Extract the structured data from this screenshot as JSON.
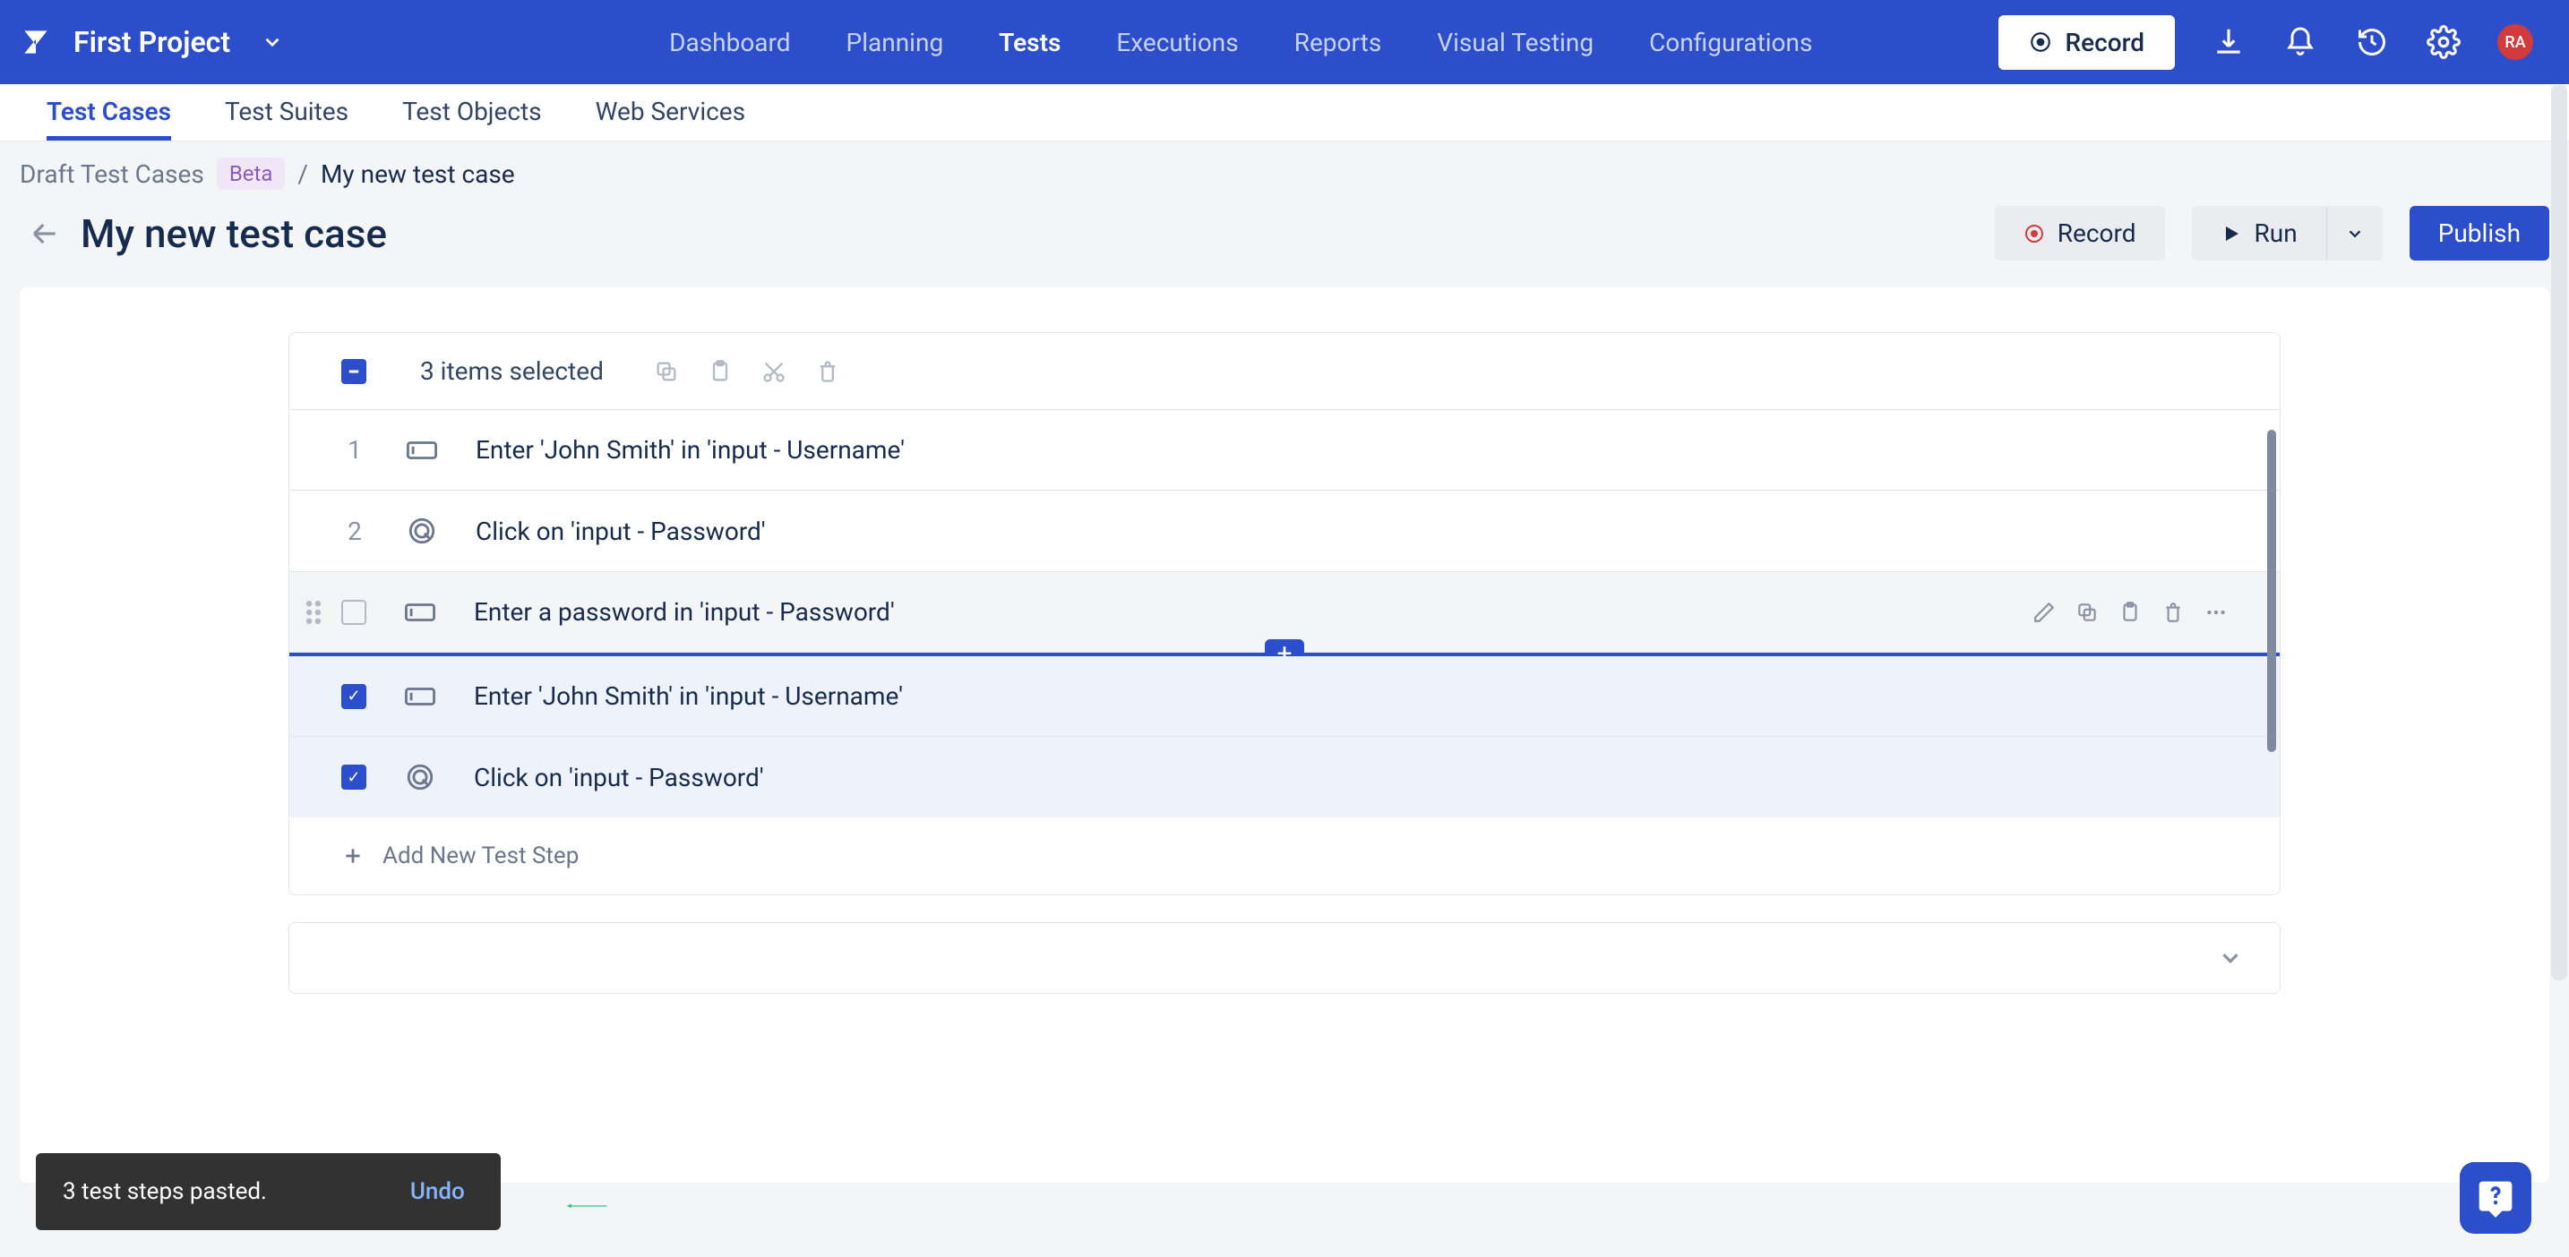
{
  "header": {
    "project_name": "First Project",
    "nav": [
      "Dashboard",
      "Planning",
      "Tests",
      "Executions",
      "Reports",
      "Visual Testing",
      "Configurations"
    ],
    "active_nav": "Tests",
    "record_label": "Record",
    "avatar_initials": "RA"
  },
  "subtabs": {
    "items": [
      "Test Cases",
      "Test Suites",
      "Test Objects",
      "Web Services"
    ],
    "active": "Test Cases"
  },
  "breadcrumb": {
    "root": "Draft Test Cases",
    "beta_label": "Beta",
    "separator": "/",
    "current": "My new test case"
  },
  "page": {
    "title": "My new test case",
    "record_label": "Record",
    "run_label": "Run",
    "publish_label": "Publish"
  },
  "selection": {
    "count_label": "3 items selected"
  },
  "steps": [
    {
      "num": "1",
      "icon": "input",
      "text": "Enter 'John Smith' in 'input - Username'",
      "state": "plain"
    },
    {
      "num": "2",
      "icon": "click",
      "text": "Click on 'input - Password'",
      "state": "plain"
    },
    {
      "num": "",
      "icon": "input",
      "text": "Enter a password in 'input - Password'",
      "state": "hover"
    },
    {
      "num": "",
      "icon": "input",
      "text": "Enter 'John Smith' in 'input - Username'",
      "state": "selected"
    },
    {
      "num": "",
      "icon": "click",
      "text": "Click on 'input - Password'",
      "state": "selected"
    }
  ],
  "add_step_label": "Add New Test Step",
  "toast": {
    "message": "3 test steps pasted.",
    "undo_label": "Undo"
  }
}
